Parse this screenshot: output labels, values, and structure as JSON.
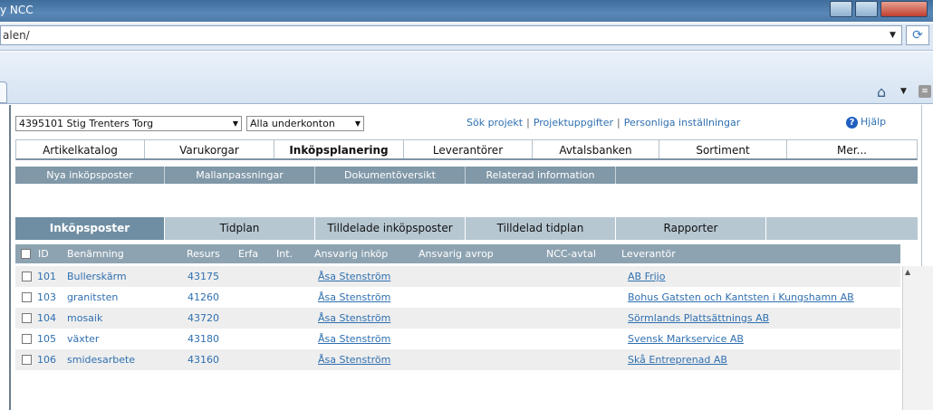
{
  "browser": {
    "title": "y NCC",
    "url": "alen/"
  },
  "controls": {
    "project_select": "4395101 Stig Trenters Torg",
    "account_select": "Alla underkonton",
    "links": [
      "Sök projekt",
      "Projektuppgifter",
      "Personliga inställningar"
    ],
    "help": "Hjälp"
  },
  "main_nav": [
    {
      "label": "Artikelkatalog"
    },
    {
      "label": "Varukorgar"
    },
    {
      "label": "Inköpsplanering"
    },
    {
      "label": "Leverantörer"
    },
    {
      "label": "Avtalsbanken"
    },
    {
      "label": "Sortiment"
    },
    {
      "label": "Mer..."
    }
  ],
  "sub_nav": [
    {
      "label": "Nya inköpsposter"
    },
    {
      "label": "Mallanpassningar"
    },
    {
      "label": "Dokumentöversikt"
    },
    {
      "label": "Relaterad information"
    }
  ],
  "tabs": [
    {
      "label": "Inköpsposter"
    },
    {
      "label": "Tidplan"
    },
    {
      "label": "Tilldelade inköpsposter"
    },
    {
      "label": "Tilldelad tidplan"
    },
    {
      "label": "Rapporter"
    }
  ],
  "table": {
    "headers": {
      "id": "ID",
      "name": "Benämning",
      "resource": "Resurs",
      "erfa": "Erfa",
      "int": "Int.",
      "buyer": "Ansvarig inköp",
      "caller": "Ansvarig avrop",
      "agreement": "NCC-avtal",
      "supplier": "Leverantör"
    },
    "rows": [
      {
        "id": "101",
        "name": "Bullerskärm",
        "resource": "43175",
        "buyer": "Åsa Stenström",
        "supplier": "AB Frijo"
      },
      {
        "id": "103",
        "name": "granitsten",
        "resource": "41260",
        "buyer": "Åsa Stenström",
        "supplier": "Bohus Gatsten och Kantsten i Kungshamn AB"
      },
      {
        "id": "104",
        "name": "mosaik",
        "resource": "43720",
        "buyer": "Åsa Stenström",
        "supplier": "Sörmlands Plattsättnings AB"
      },
      {
        "id": "105",
        "name": "växter",
        "resource": "43180",
        "buyer": "Åsa Stenström",
        "supplier": "Svensk Markservice AB"
      },
      {
        "id": "106",
        "name": "smidesarbete",
        "resource": "43160",
        "buyer": "Åsa Stenström",
        "supplier": "Skå Entreprenad AB"
      }
    ]
  },
  "colors": {
    "link": "#2f6fb0",
    "subnav_bg": "#8098a8",
    "active_tab_bg": "#6f8ea3",
    "table_header_bg": "#8ea3b1"
  }
}
